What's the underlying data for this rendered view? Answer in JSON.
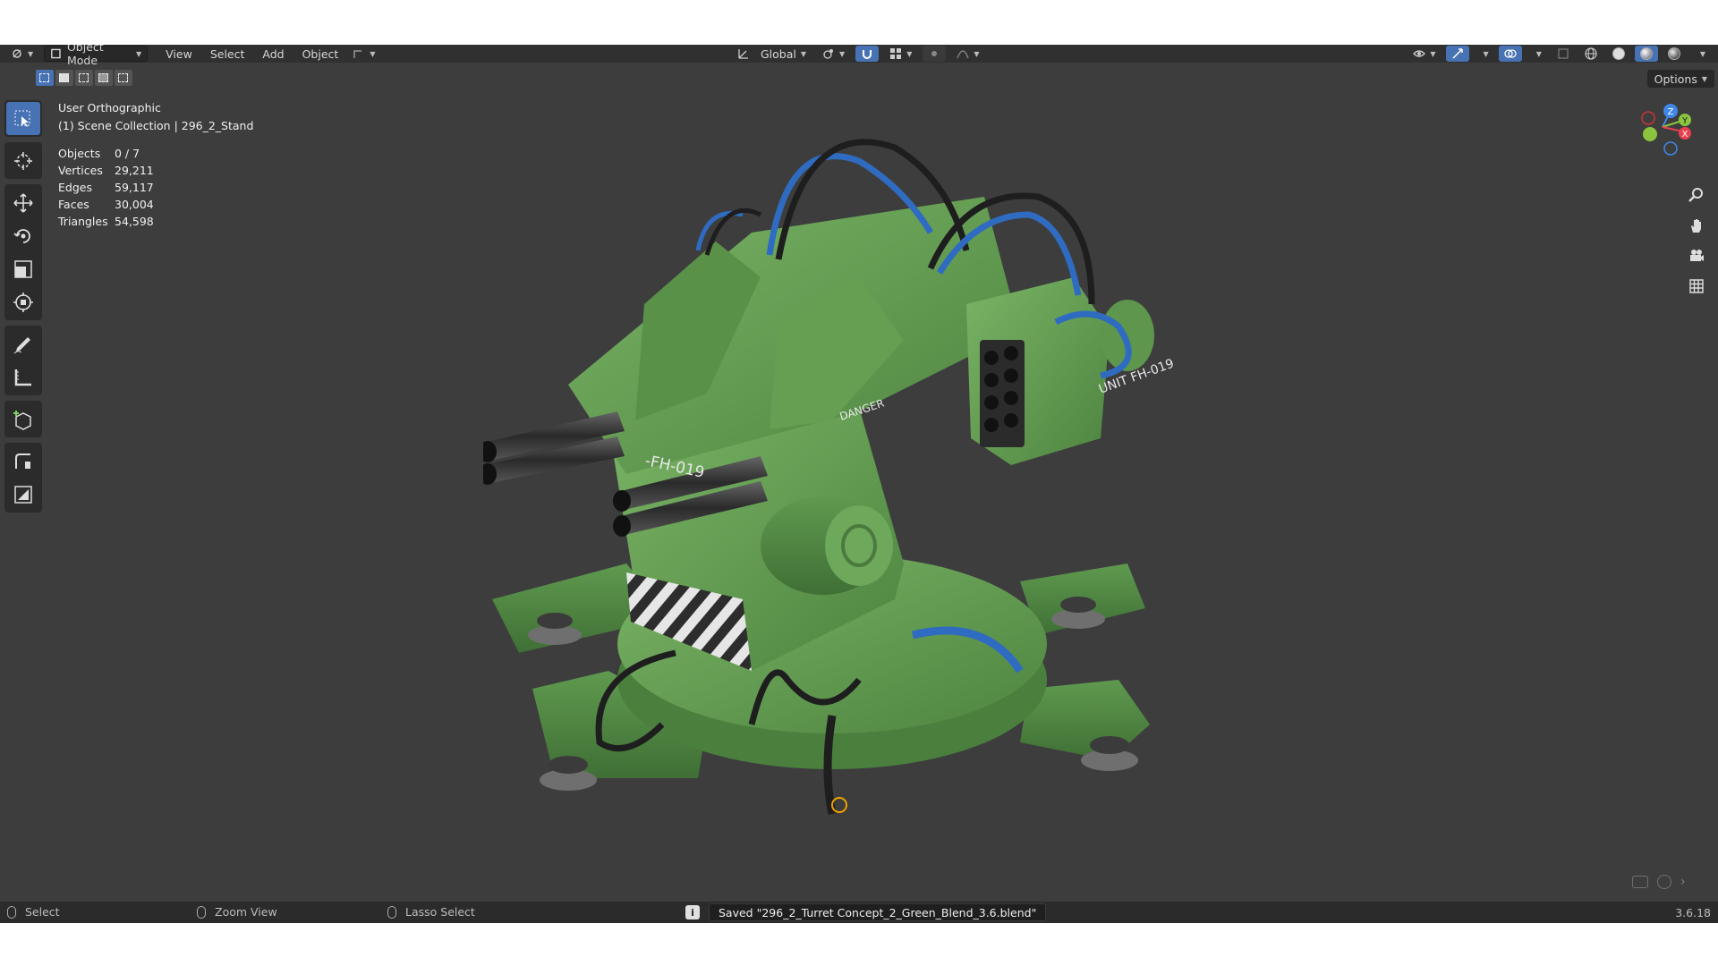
{
  "header": {
    "mode_label": "Object Mode",
    "menus": [
      "View",
      "Select",
      "Add",
      "Object"
    ],
    "transform_orientation": "Global"
  },
  "toolbar_header": {
    "options_label": "Options"
  },
  "viewport": {
    "view_name": "User Orthographic",
    "collection_line": "(1) Scene Collection | 296_2_Stand",
    "stats": [
      {
        "label": "Objects",
        "value": "0 / 7"
      },
      {
        "label": "Vertices",
        "value": "29,211"
      },
      {
        "label": "Edges",
        "value": "59,117"
      },
      {
        "label": "Faces",
        "value": "30,004"
      },
      {
        "label": "Triangles",
        "value": "54,598"
      }
    ],
    "gizmo_axes": {
      "z": "Z",
      "y": "Y",
      "x": "X"
    },
    "model_decals": {
      "unit_text": "UNIT\nFH-019",
      "side_text": "-FH-019",
      "danger_text": "DANGER"
    }
  },
  "tools": [
    "select-box",
    "cursor",
    "move",
    "rotate",
    "scale",
    "transform",
    "annotate",
    "measure",
    "add-cube",
    "spin",
    "shear"
  ],
  "status": {
    "select_label": "Select",
    "zoom_label": "Zoom View",
    "lasso_label": "Lasso Select",
    "saved_message": "Saved \"296_2_Turret Concept_2_Green_Blend_3.6.blend\"",
    "version": "3.6.18"
  },
  "colors": {
    "accent": "#4772b3",
    "viewport_bg": "#3d3d3d",
    "model_green": "#5f9a4f",
    "axis_x": "#e8404f",
    "axis_y": "#8bc53f",
    "axis_z": "#3f87e8"
  }
}
